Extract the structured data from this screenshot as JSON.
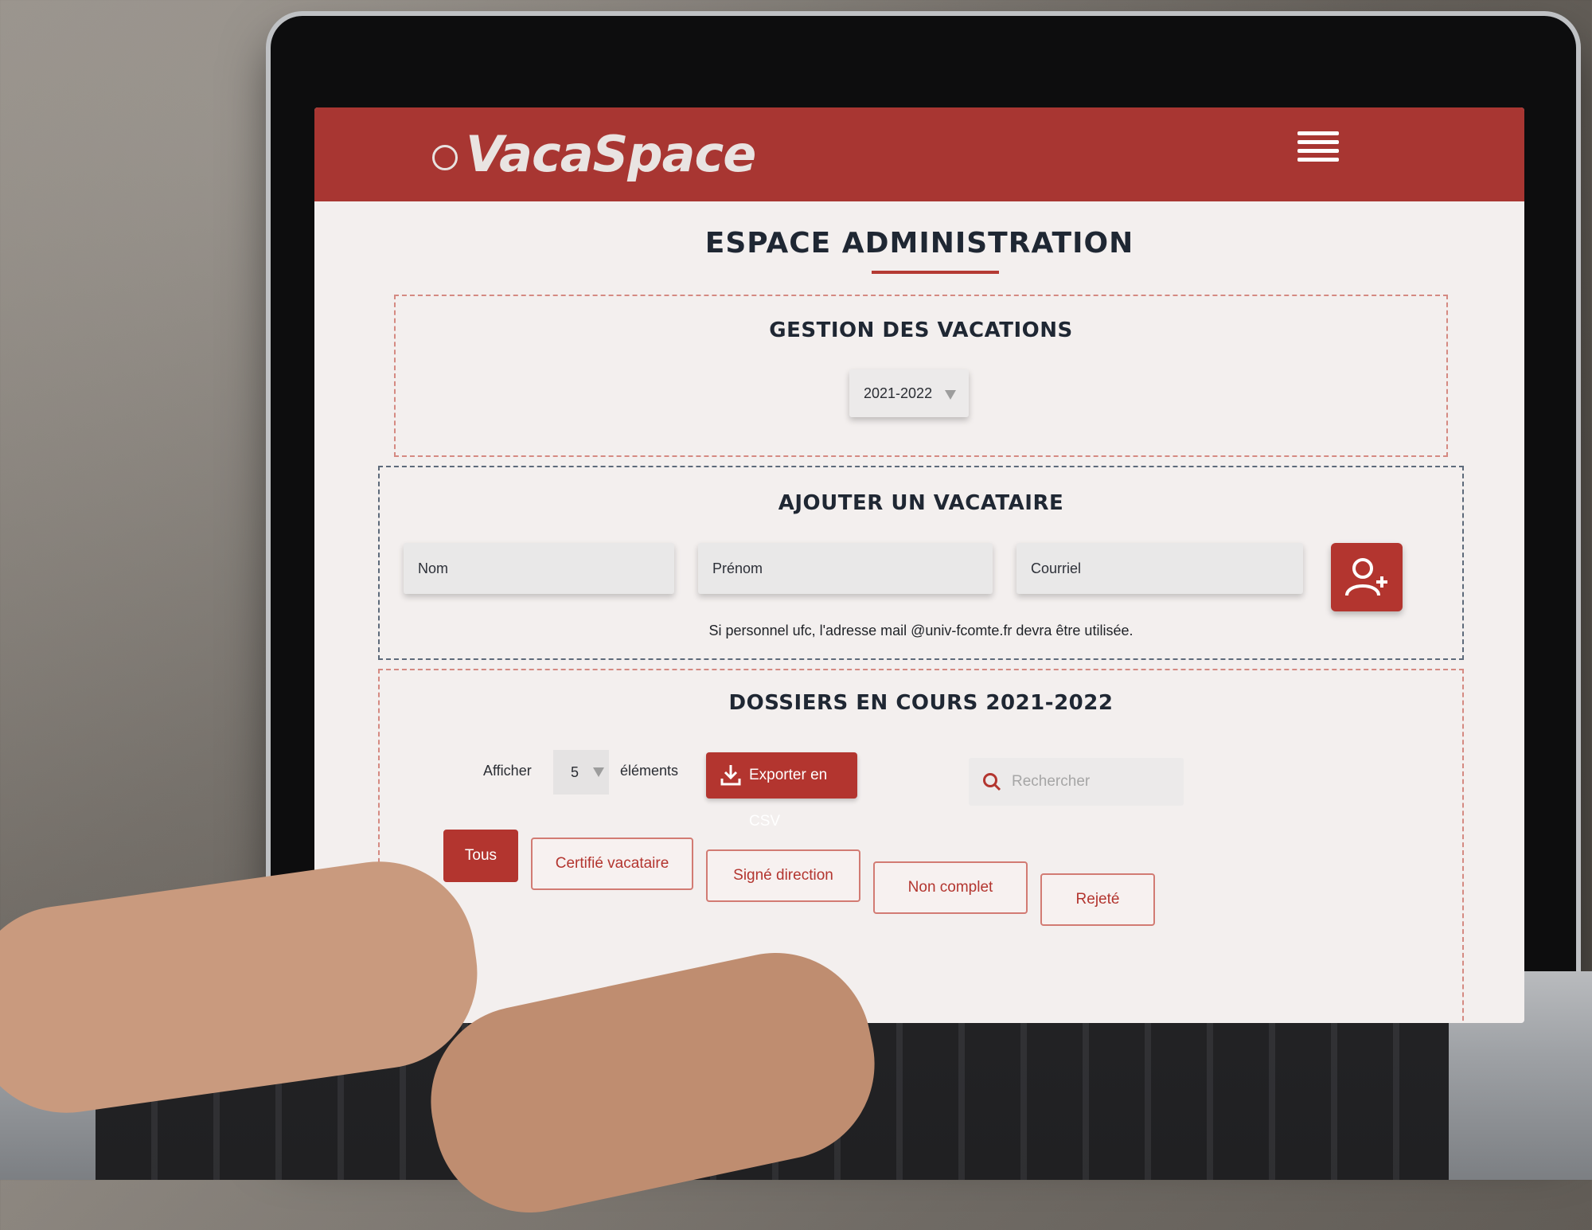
{
  "app": {
    "name": "VacaSpace",
    "page_title": "ESPACE ADMINISTRATION"
  },
  "colors": {
    "brand": "#a83632",
    "accent": "#b3352f",
    "text": "#1f2733",
    "background": "#f3efee"
  },
  "gestion": {
    "heading": "GESTION DES VACATIONS",
    "year_selected": "2021-2022"
  },
  "ajout": {
    "heading": "AJOUTER UN VACATAIRE",
    "nom_placeholder": "Nom",
    "prenom_placeholder": "Prénom",
    "courriel_placeholder": "Courriel",
    "add_icon": "user-plus-icon",
    "hint": "Si personnel ufc, l'adresse mail @univ-fcomte.fr devra être utilisée."
  },
  "dossiers": {
    "heading": "DOSSIERS EN COURS 2021-2022",
    "afficher_label": "Afficher",
    "page_size": "5",
    "elements_label": "éléments",
    "export_label": "Exporter en CSV",
    "export_icon": "download-icon",
    "search_placeholder": "Rechercher",
    "search_icon": "search-icon",
    "filters": [
      {
        "label": "Tous",
        "active": true
      },
      {
        "label": "Certifié vacataire",
        "active": false
      },
      {
        "label": "Signé direction",
        "active": false
      },
      {
        "label": "Non complet",
        "active": false
      },
      {
        "label": "Rejeté",
        "active": false
      }
    ]
  }
}
